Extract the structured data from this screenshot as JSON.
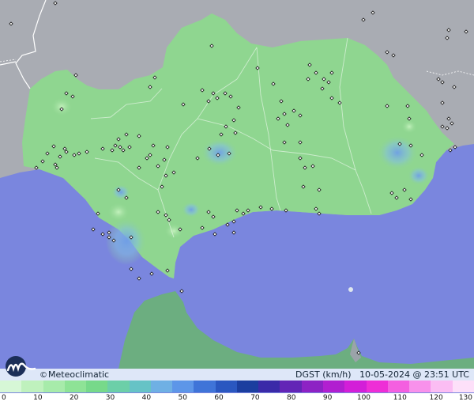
{
  "credit": {
    "symbol": "©",
    "text": "Meteoclimatic"
  },
  "variable": "DGST (km/h)",
  "datetime": "10-05-2024 @ 23:51 UTC",
  "colors": {
    "sea": "#7a86de",
    "land_outside": "#a9acb3",
    "region_fill": "#8fd690",
    "north_africa": "#6cae80",
    "borders": "#ffffff"
  },
  "icons": {
    "logo": "meteoclimatic-logo",
    "station": "station-marker"
  },
  "scale": {
    "labels": [
      "0",
      "10",
      "20",
      "30",
      "40",
      "50",
      "60",
      "70",
      "80",
      "90",
      "100",
      "110",
      "120",
      "130"
    ],
    "colors": [
      "#d6f7d6",
      "#bff1bd",
      "#a7ebaa",
      "#8ee396",
      "#77d98a",
      "#6ccfa8",
      "#66c3c6",
      "#6fb0e4",
      "#5d96e8",
      "#3f74d8",
      "#2a57c0",
      "#1b3e9f",
      "#3a2aa8",
      "#6325b6",
      "#8d22c4",
      "#b11fd0",
      "#d31fd8",
      "#ee2ed6",
      "#f45fe0",
      "#f891eb",
      "#fbbdf3",
      "#fde0f9"
    ]
  }
}
